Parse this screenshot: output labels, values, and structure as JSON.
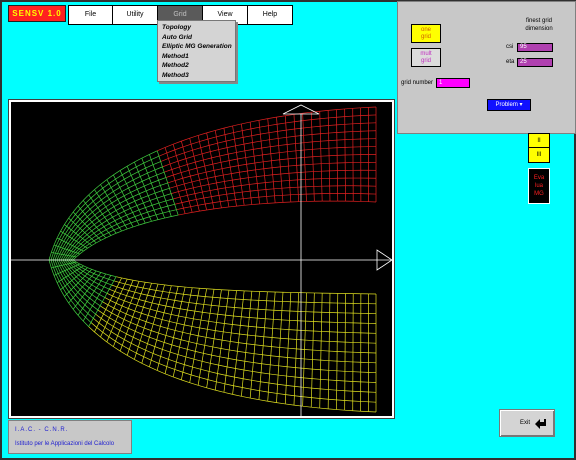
{
  "app_badge": "SENSV  1.0",
  "menu": [
    {
      "label": "File"
    },
    {
      "label": "Utility"
    },
    {
      "label": "Grid"
    },
    {
      "label": "View"
    },
    {
      "label": "Help"
    }
  ],
  "dropdown": [
    "Topology",
    "Auto Grid",
    "Elliptic MG Generation",
    "Method1",
    "Method2",
    "Method3"
  ],
  "panel": {
    "title_line1": "finest grid",
    "title_line2": "dimension",
    "one_grid_line1": "one",
    "one_grid_line2": "grid",
    "multi_grid_line1": "mult",
    "multi_grid_line2": "grid",
    "csi_label": "csi",
    "csi_value": "95",
    "eta_label": "eta",
    "eta_value": "25",
    "grid_number_label": "grid number",
    "grid_number_value": "1",
    "select_label": "Problem"
  },
  "side_buttons": {
    "top_a": "II",
    "top_b": "III",
    "evaluate_line1": "Eva",
    "evaluate_line2": "lua",
    "evaluate_line3": "MG"
  },
  "info": {
    "line1": "I.A.C. - C.N.R.",
    "line2": "Istituto per le Applicazioni del Calcolo"
  },
  "exit_label": "Exit",
  "colors": {
    "background": "#00ffff",
    "canvas": "#000000",
    "grid_red": "#e02020",
    "grid_green": "#40d040",
    "grid_yellow": "#e0e020"
  }
}
